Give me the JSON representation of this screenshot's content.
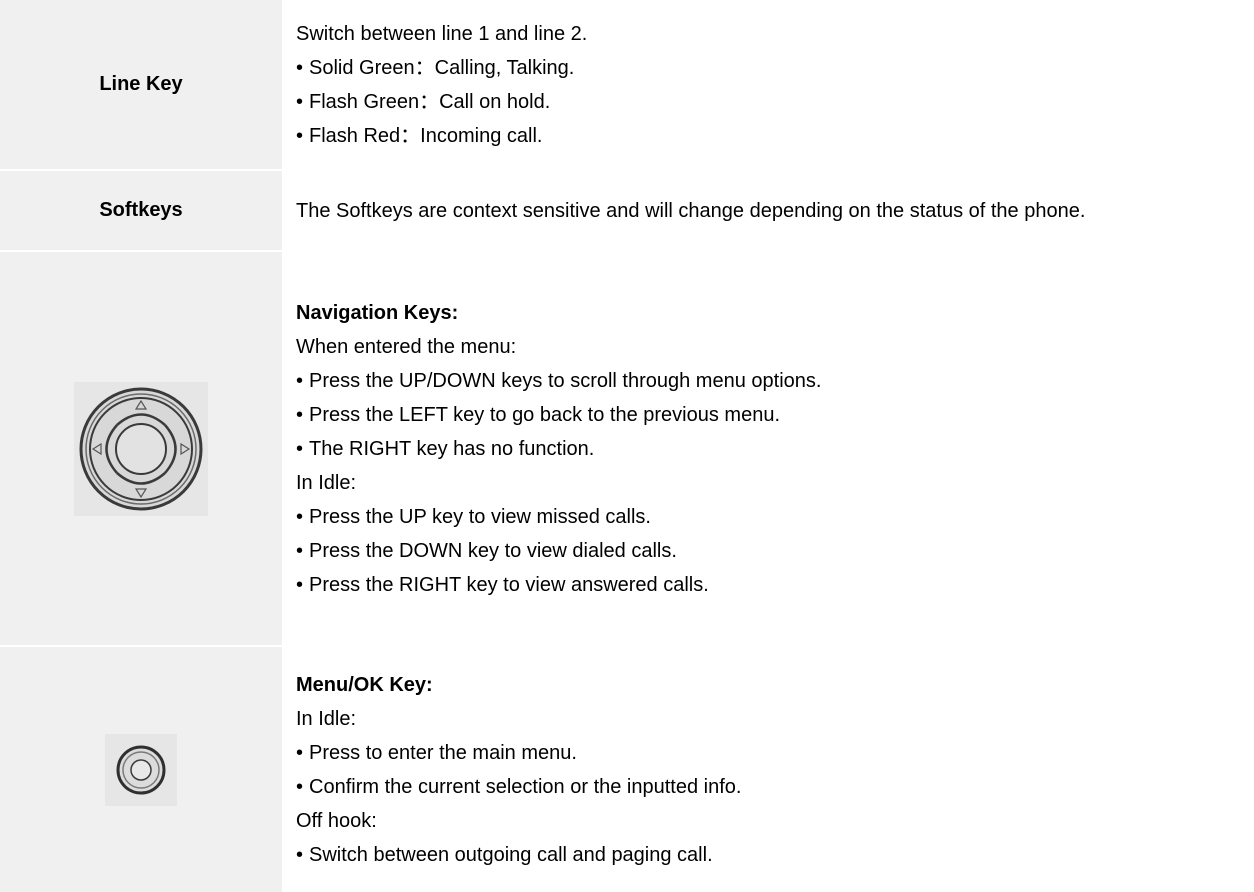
{
  "rows": [
    {
      "key": "Line Key",
      "lines": [
        "Switch between line 1 and line 2.",
        "Solid Green：Calling, Talking.",
        "Flash Green：Call on hold.",
        "Flash Red：Incoming call."
      ]
    },
    {
      "key": "Softkeys",
      "text": "The Softkeys are context sensitive and will change depending on the status of the phone."
    },
    {
      "icon": "navigation-keys-icon",
      "title": "Navigation Keys:",
      "lines": [
        "When entered the menu:",
        "Press the UP/DOWN keys to scroll through menu options.",
        "Press the LEFT key to go back to the previous menu.",
        "The RIGHT key has no function.",
        "In Idle:",
        "Press the UP key to view missed calls.",
        "Press the DOWN key to view dialed calls.",
        "Press the RIGHT key to view answered calls."
      ]
    },
    {
      "icon": "menu-ok-key-icon",
      "title": "Menu/OK Key:",
      "lines": [
        "In Idle:",
        "Press to enter the main menu.",
        "Confirm the current selection or the inputted info.",
        "Off hook:",
        "Switch between outgoing call and paging call."
      ]
    }
  ],
  "colors": {
    "label_cell_bg": "#f0f0f0",
    "icon_bg": "#e6e6e6",
    "text": "#000000"
  }
}
